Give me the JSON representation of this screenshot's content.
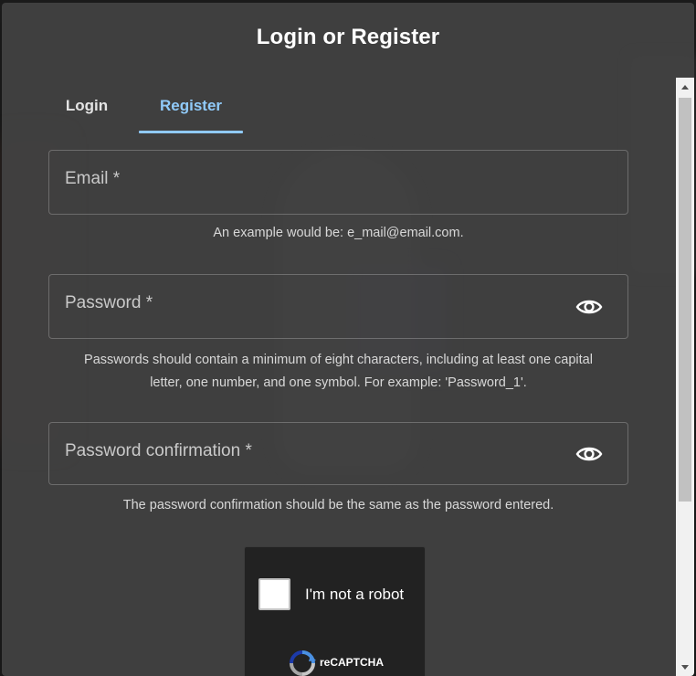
{
  "dialog": {
    "title": "Login or Register"
  },
  "tabs": [
    {
      "label": "Login",
      "active": false
    },
    {
      "label": "Register",
      "active": true
    }
  ],
  "form": {
    "email": {
      "label": "Email *",
      "hint": "An example would be: e_mail@email.com."
    },
    "password": {
      "label": "Password *",
      "hint_line1": "Passwords should contain a minimum of eight characters, including at least one capital",
      "hint_line2": "letter, one number, and one symbol. For example: 'Password_1'.",
      "visibility_icon": "eye-icon"
    },
    "password_confirmation": {
      "label": "Password confirmation *",
      "hint": "The password confirmation should be the same as the password entered.",
      "visibility_icon": "eye-icon"
    }
  },
  "recaptcha": {
    "checkbox_label": "I'm not a robot",
    "brand": "reCAPTCHA",
    "icon": "recaptcha-logo-icon"
  },
  "colors": {
    "accent": "#90caf9",
    "dialog_bg": "#424242"
  }
}
